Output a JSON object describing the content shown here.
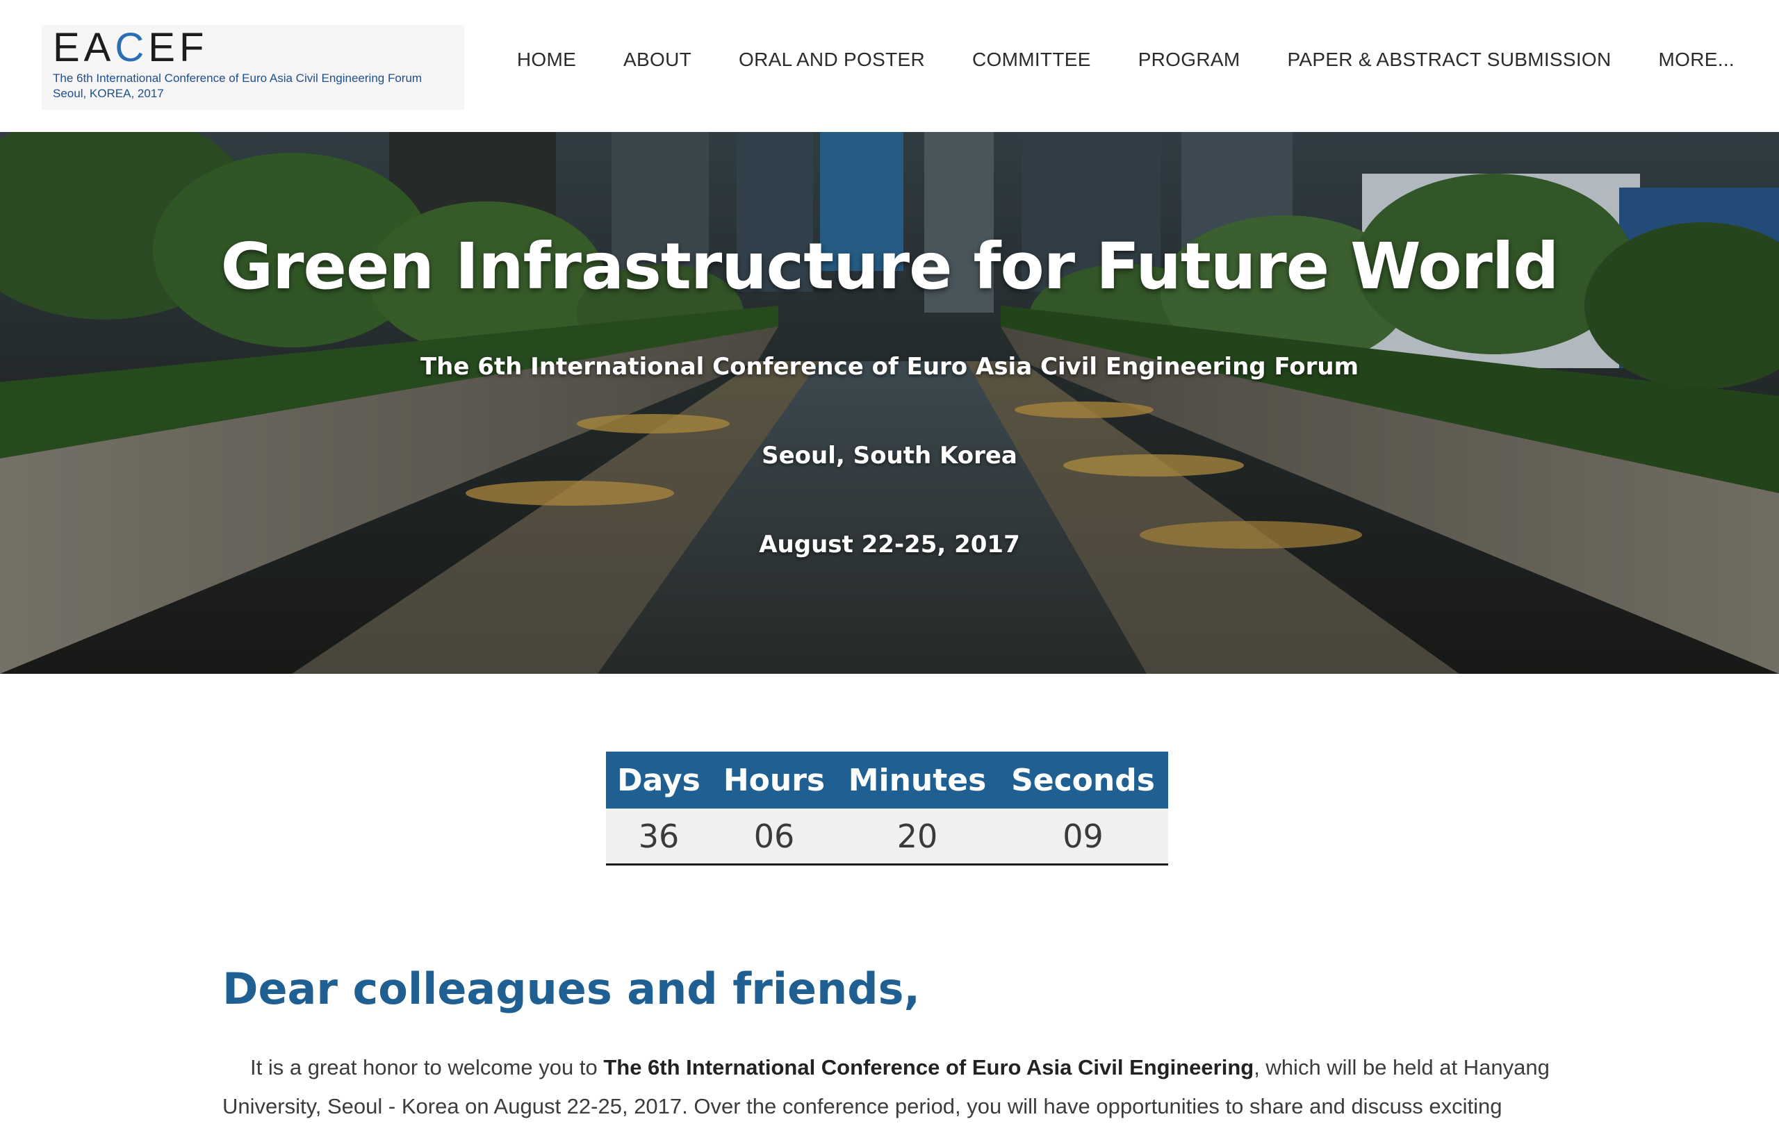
{
  "header": {
    "logo": {
      "mark_left": "EA",
      "mark_accent": "C",
      "mark_right": "EF",
      "line1": "The 6th International Conference of Euro Asia Civil Engineering Forum",
      "line2": "Seoul, KOREA, 2017"
    },
    "nav": [
      {
        "label": "HOME"
      },
      {
        "label": "ABOUT"
      },
      {
        "label": "ORAL AND POSTER"
      },
      {
        "label": "COMMITTEE"
      },
      {
        "label": "PROGRAM"
      },
      {
        "label": "PAPER & ABSTRACT SUBMISSION"
      },
      {
        "label": "MORE..."
      }
    ]
  },
  "hero": {
    "title": "Green Infrastructure for Future World",
    "subtitle": "The 6th International Conference of Euro Asia Civil Engineering Forum",
    "location": "Seoul, South Korea",
    "date": "August  22-25, 2017"
  },
  "countdown": {
    "labels": {
      "days": "Days",
      "hours": "Hours",
      "minutes": "Minutes",
      "seconds": "Seconds"
    },
    "values": {
      "days": "36",
      "hours": "06",
      "minutes": "20",
      "seconds": "09"
    }
  },
  "welcome": {
    "heading": "Dear colleagues and friends,",
    "intro": "It is a great honor to welcome you to ",
    "conference_name": "The 6th International Conference of Euro Asia Civil  Engineering",
    "rest": ", which will be held at Hanyang University, Seoul - Korea on August 22-25, 2017. Over the conference period, you will have opportunities to share and discuss exciting"
  },
  "colors": {
    "accent": "#1f5f92",
    "nav_text": "#2b2b2b",
    "logo_blue": "#1f4e8c"
  }
}
